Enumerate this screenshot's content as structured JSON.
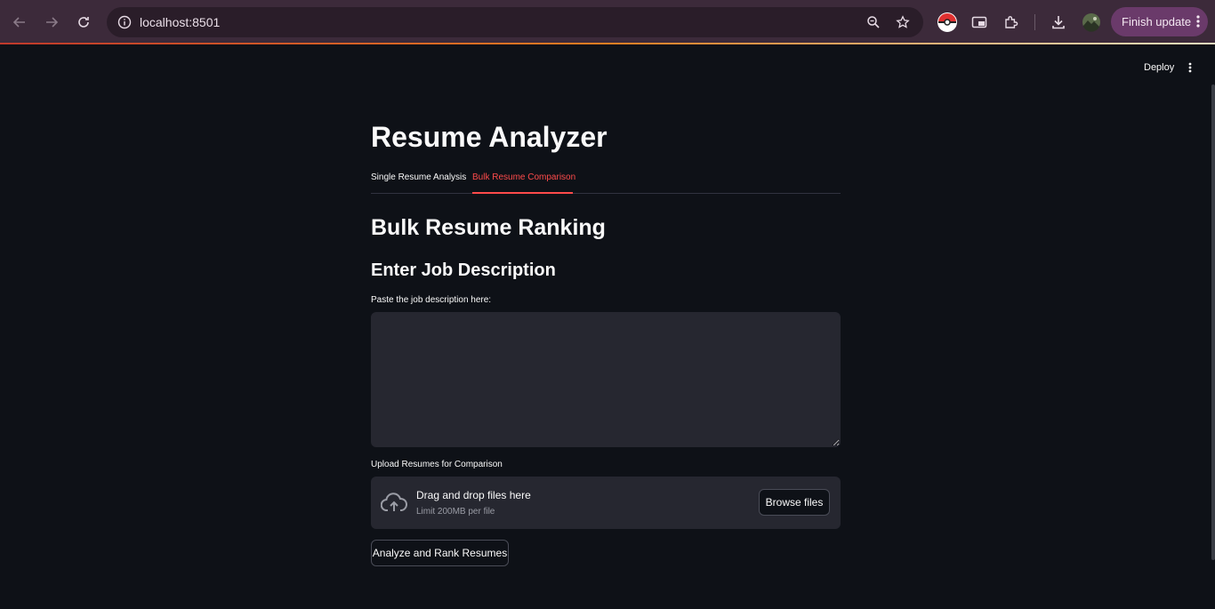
{
  "browser": {
    "url": "localhost:8501",
    "finish_update_label": "Finish update"
  },
  "app_header": {
    "deploy_label": "Deploy"
  },
  "main": {
    "title": "Resume Analyzer",
    "tabs": [
      {
        "label": "Single Resume Analysis",
        "active": false
      },
      {
        "label": "Bulk Resume Comparison",
        "active": true
      }
    ],
    "section_title": "Bulk Resume Ranking",
    "subsection_title": "Enter Job Description",
    "job_description": {
      "label": "Paste the job description here:",
      "value": ""
    },
    "uploader": {
      "label": "Upload Resumes for Comparison",
      "drag_text": "Drag and drop files here",
      "limit_text": "Limit 200MB per file",
      "browse_label": "Browse files"
    },
    "analyze_label": "Analyze and Rank Resumes"
  },
  "colors": {
    "background": "#0e1117",
    "accent": "#ff4b4b",
    "widget_bg": "#262730",
    "browser_toolbar": "#3c2a3a"
  }
}
